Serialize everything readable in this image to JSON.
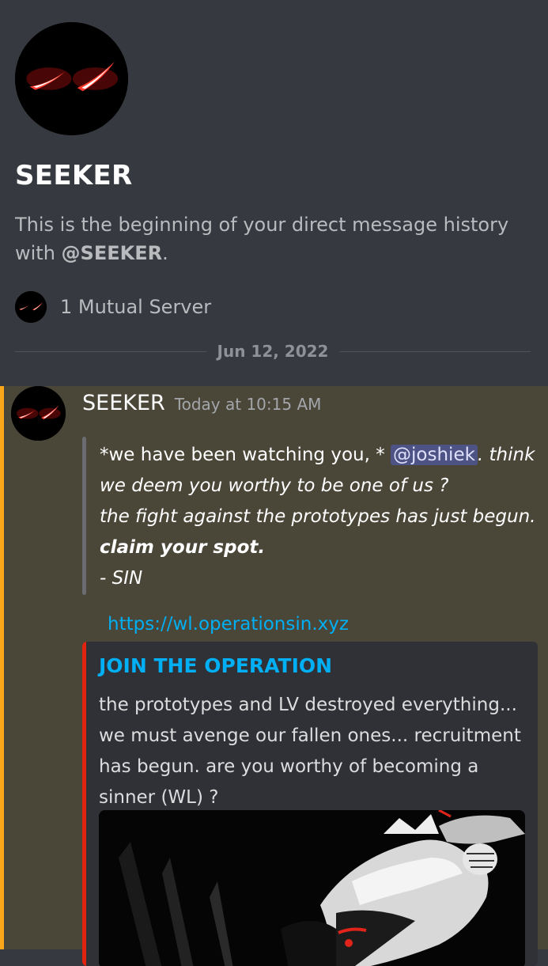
{
  "dm": {
    "name": "SEEKER",
    "description_prefix": "This is the beginning of your direct message history with ",
    "description_handle": "@SEEKER",
    "description_suffix": ".",
    "mutual_servers": "1 Mutual Server",
    "date_divider": "Jun 12, 2022"
  },
  "message": {
    "author": "SEEKER",
    "timestamp": "Today at 10:15 AM",
    "quote": {
      "line1_plain": "*we have been watching you, * ",
      "mention": "@joshiek",
      "line1_italic": ". think",
      "line2": "we deem you worthy to be one of us ?",
      "line3": "the fight against the prototypes has just begun.",
      "line4": "claim your spot.",
      "line5": "- SIN"
    },
    "link": "https://wl.operationsin.xyz",
    "embed": {
      "title": "JOIN THE OPERATION",
      "description": "the prototypes and LV destroyed everything... we must avenge our fallen ones... recruitment has begun. are you worthy of becoming a sinner (WL) ?",
      "image_icon": "artwork-image"
    }
  },
  "colors": {
    "background": "#36393f",
    "mention_highlight": "#4a4638",
    "mention_bar": "#faa81a",
    "link": "#00aff4",
    "embed_accent": "#e02410",
    "avatar_eyes": "#ff3b2f"
  },
  "icons": {
    "avatar": "glowing-red-eyes-avatar"
  }
}
